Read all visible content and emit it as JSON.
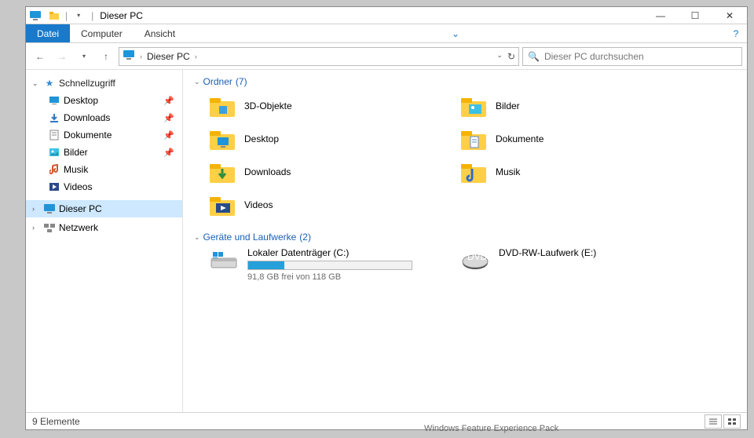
{
  "window": {
    "title": "Dieser PC"
  },
  "ribbon": {
    "file": "Datei",
    "tabs": [
      "Computer",
      "Ansicht"
    ]
  },
  "nav": {
    "breadcrumb_root": "Dieser PC",
    "search_placeholder": "Dieser PC durchsuchen"
  },
  "sidebar": {
    "quick": {
      "label": "Schnellzugriff"
    },
    "quick_items": [
      {
        "label": "Desktop",
        "pinned": true
      },
      {
        "label": "Downloads",
        "pinned": true
      },
      {
        "label": "Dokumente",
        "pinned": true
      },
      {
        "label": "Bilder",
        "pinned": true
      },
      {
        "label": "Musik",
        "pinned": false
      },
      {
        "label": "Videos",
        "pinned": false
      }
    ],
    "this_pc": "Dieser PC",
    "network": "Netzwerk"
  },
  "groups": {
    "folders": {
      "label": "Ordner",
      "count": "(7)"
    },
    "folders_items": [
      {
        "label": "3D-Objekte",
        "kind": "3d"
      },
      {
        "label": "Bilder",
        "kind": "pic"
      },
      {
        "label": "Desktop",
        "kind": "desk"
      },
      {
        "label": "Dokumente",
        "kind": "doc"
      },
      {
        "label": "Downloads",
        "kind": "dl"
      },
      {
        "label": "Musik",
        "kind": "music"
      },
      {
        "label": "Videos",
        "kind": "vid"
      }
    ],
    "drives": {
      "label": "Geräte und Laufwerke",
      "count": "(2)"
    },
    "drives_items": [
      {
        "label": "Lokaler Datenträger (C:)",
        "free_text": "91,8 GB frei von 118 GB",
        "used_pct": 22,
        "kind": "hdd"
      },
      {
        "label": "DVD-RW-Laufwerk (E:)",
        "kind": "dvd"
      }
    ]
  },
  "status": {
    "count_text": "9 Elemente"
  },
  "background_hint": "Windows Feature Experience Pack"
}
